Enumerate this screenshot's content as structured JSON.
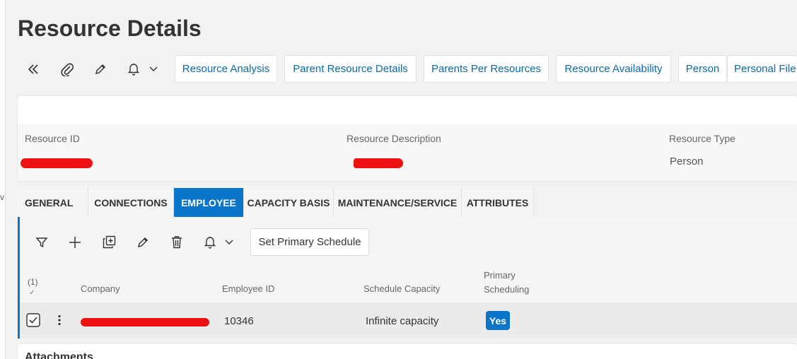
{
  "page": {
    "title": "Resource Details",
    "left_mark": "v"
  },
  "toolbar": {
    "icons": [
      "double-chevron-left-icon",
      "paperclip-icon",
      "pencil-icon",
      "bell-icon",
      "chevron-down-icon"
    ],
    "buttons": [
      "Resource Analysis",
      "Parent Resource Details",
      "Parents Per Resources",
      "Resource Availability",
      "Person",
      "Personal File"
    ]
  },
  "header": {
    "fields": [
      {
        "label": "Resource ID",
        "value": ""
      },
      {
        "label": "Resource Description",
        "value": ""
      },
      {
        "label": "Resource Type",
        "value": "Person"
      }
    ]
  },
  "tabs": [
    {
      "label": "GENERAL",
      "active": false
    },
    {
      "label": "CONNECTIONS",
      "active": false
    },
    {
      "label": "EMPLOYEE",
      "active": true
    },
    {
      "label": "CAPACITY BASIS",
      "active": false
    },
    {
      "label": "MAINTENANCE/SERVICE",
      "active": false
    },
    {
      "label": "ATTRIBUTES",
      "active": false
    }
  ],
  "employee": {
    "toolbar": {
      "icons": [
        "filter-icon",
        "plus-icon",
        "duplicate-icon",
        "pencil-icon",
        "trash-icon",
        "bell-icon",
        "chevron-down-icon"
      ],
      "set_primary_label": "Set Primary Schedule"
    },
    "table": {
      "selection_count": "(1)",
      "columns": [
        "Company",
        "Employee ID",
        "Schedule Capacity",
        "Primary Scheduling"
      ],
      "rows": [
        {
          "company": "",
          "employee_id": "10346",
          "schedule_capacity": "Infinite capacity",
          "primary_scheduling": "Yes",
          "selected": true
        }
      ]
    }
  },
  "attachments": {
    "title": "Attachments"
  },
  "colors": {
    "accent": "#0b75c9",
    "link": "#0b6aa9",
    "redaction": "#ee1111"
  }
}
